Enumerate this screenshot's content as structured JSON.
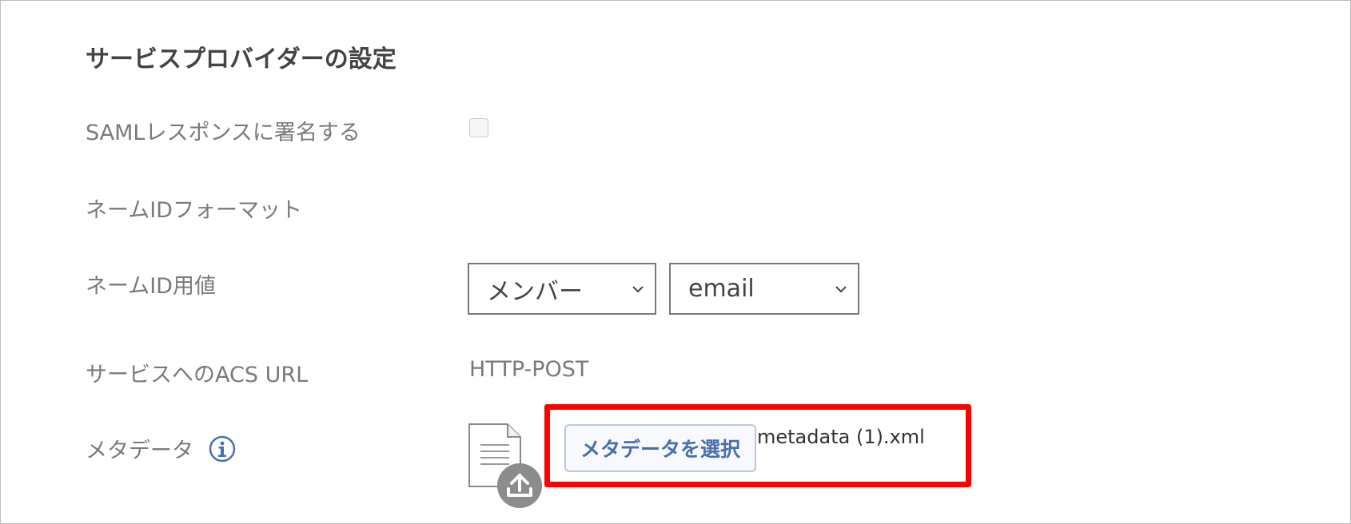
{
  "section": {
    "title": "サービスプロバイダーの設定"
  },
  "fields": {
    "sign_saml": {
      "label": "SAMLレスポンスに署名する",
      "checked": false
    },
    "nameid_format": {
      "label": "ネームIDフォーマット"
    },
    "nameid_value": {
      "label": "ネームID用値",
      "source_selected": "メンバー",
      "attribute_selected": "email"
    },
    "acs_url": {
      "label": "サービスへのACS URL",
      "value": "HTTP-POST"
    },
    "metadata": {
      "label": "メタデータ",
      "button_label": "メタデータを選択",
      "filename": "metadata (1).xml"
    }
  },
  "icons": {
    "info": "info-icon",
    "document": "document-icon",
    "upload": "upload-icon",
    "chevron": "chevron-down-icon"
  },
  "colors": {
    "highlight": "#ff0000",
    "link_blue": "#4a6fae",
    "upload_gray": "#8c8c8c"
  }
}
